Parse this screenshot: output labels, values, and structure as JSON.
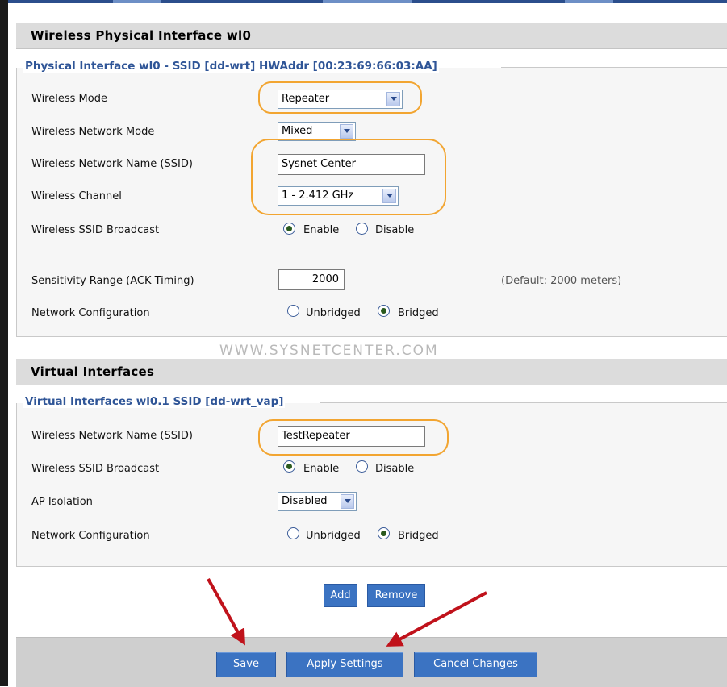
{
  "physical": {
    "header": "Wireless Physical Interface wl0",
    "legend": "Physical Interface wl0 - SSID [dd-wrt] HWAddr [00:23:69:66:03:AA]",
    "wireless_mode": {
      "label": "Wireless Mode",
      "value": "Repeater"
    },
    "network_mode": {
      "label": "Wireless Network Mode",
      "value": "Mixed"
    },
    "ssid": {
      "label": "Wireless Network Name (SSID)",
      "value": "Sysnet Center"
    },
    "channel": {
      "label": "Wireless Channel",
      "value": "1 - 2.412 GHz"
    },
    "ssid_broadcast": {
      "label": "Wireless SSID Broadcast",
      "enable": "Enable",
      "disable": "Disable",
      "selected": "Enable"
    },
    "sensitivity": {
      "label": "Sensitivity Range (ACK Timing)",
      "value": "2000",
      "hint": "(Default: 2000 meters)"
    },
    "network_config": {
      "label": "Network Configuration",
      "unbridged": "Unbridged",
      "bridged": "Bridged",
      "selected": "Bridged"
    }
  },
  "watermark": "WWW.SYSNETCENTER.COM",
  "virtual": {
    "header": "Virtual Interfaces",
    "legend": "Virtual Interfaces wl0.1 SSID [dd-wrt_vap]",
    "ssid": {
      "label": "Wireless Network Name (SSID)",
      "value": "TestRepeater"
    },
    "ssid_broadcast": {
      "label": "Wireless SSID Broadcast",
      "enable": "Enable",
      "disable": "Disable",
      "selected": "Enable"
    },
    "ap_isolation": {
      "label": "AP Isolation",
      "value": "Disabled"
    },
    "network_config": {
      "label": "Network Configuration",
      "unbridged": "Unbridged",
      "bridged": "Bridged",
      "selected": "Bridged"
    },
    "add_label": "Add",
    "remove_label": "Remove"
  },
  "footer": {
    "save_label": "Save",
    "apply_label": "Apply Settings",
    "cancel_label": "Cancel Changes"
  },
  "colors": {
    "button_blue": "#3b73c2",
    "legend_blue": "#2f5597",
    "highlight_orange": "#f2a531",
    "arrow_red": "#c0121b"
  }
}
